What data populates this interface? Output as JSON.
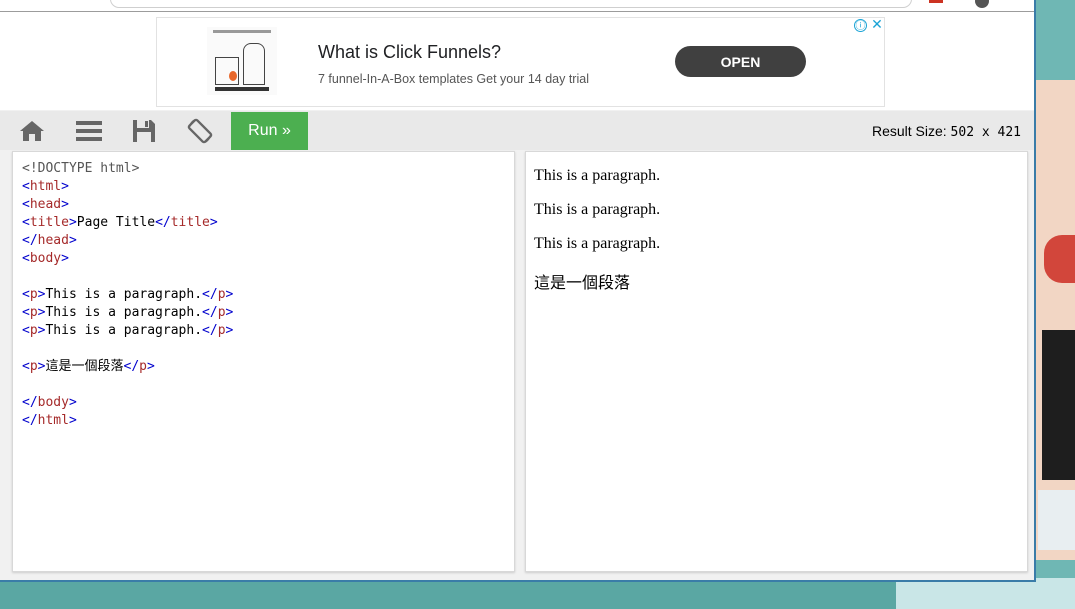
{
  "ad": {
    "title": "What is Click Funnels?",
    "description": "7 funnel-In-A-Box templates Get your 14 day trial",
    "open_label": "OPEN",
    "info_glyph": "ⓘ",
    "close_glyph": "✕"
  },
  "toolbar": {
    "icons": [
      "home-icon",
      "menu-icon",
      "save-icon",
      "rotate-icon"
    ],
    "run_label": "Run »",
    "result_size_label": "Result Size:",
    "result_size_value": "502 x 421"
  },
  "editor": {
    "lines": [
      "<!DOCTYPE html>",
      "<html>",
      "<head>",
      "<title>Page Title</title>",
      "</head>",
      "<body>",
      "",
      "<p>This is a paragraph.</p>",
      "<p>This is a paragraph.</p>",
      "<p>This is a paragraph.</p>",
      "",
      "<p>這是一個段落</p>",
      "",
      "</body>",
      "</html>"
    ]
  },
  "result": {
    "paragraphs": [
      "This is a paragraph.",
      "This is a paragraph.",
      "This is a paragraph.",
      "這是一個段落"
    ]
  },
  "colors": {
    "run_button": "#4caf50",
    "tag_name": "#a52a2a",
    "tag_bracket": "#0000cd",
    "open_button": "#404040",
    "ad_icons": "#1aa3d5"
  }
}
